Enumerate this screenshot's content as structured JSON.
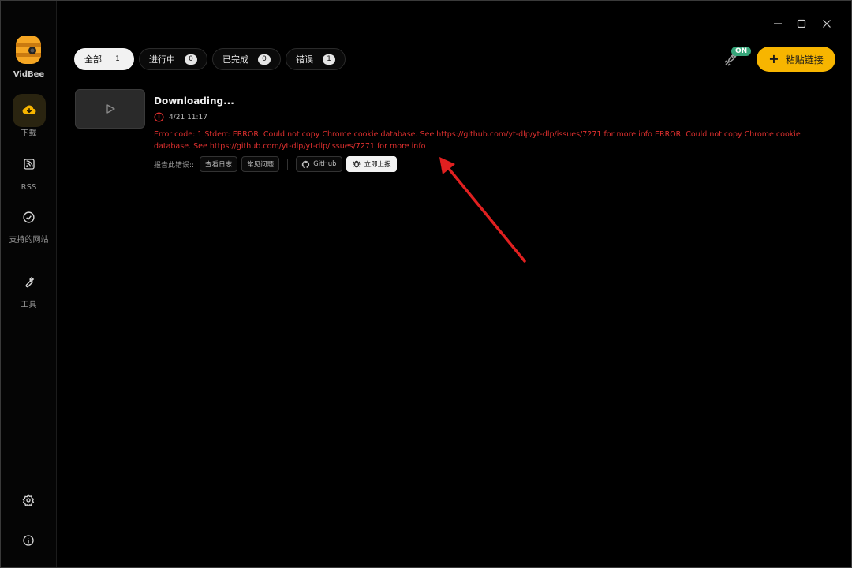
{
  "app": {
    "name": "VidBee"
  },
  "sidebar": {
    "items": [
      {
        "label": "下载",
        "icon": "download-cloud-icon",
        "active": true
      },
      {
        "label": "RSS",
        "icon": "rss-icon",
        "active": false
      },
      {
        "label": "支持的网站",
        "icon": "check-circle-icon",
        "active": false
      },
      {
        "label": "工具",
        "icon": "wrench-icon",
        "active": false
      }
    ],
    "bottom": [
      {
        "icon": "gear-icon"
      },
      {
        "icon": "info-icon"
      }
    ]
  },
  "window_controls": [
    "minimize-icon",
    "maximize-icon",
    "close-icon"
  ],
  "filters": [
    {
      "label": "全部",
      "count": "1",
      "active": true
    },
    {
      "label": "进行中",
      "count": "0",
      "active": false
    },
    {
      "label": "已完成",
      "count": "0",
      "active": false
    },
    {
      "label": "错误",
      "count": "1",
      "active": false
    }
  ],
  "toolbar": {
    "on_badge": "ON",
    "paste_label": "粘贴链接",
    "paste_icon": "plus-icon",
    "rocket_icon": "rocket-icon"
  },
  "download": {
    "title": "Downloading...",
    "date": "4/21 11:17",
    "error": "Error code: 1 Stderr: ERROR: Could not copy Chrome cookie database. See https://github.com/yt-dlp/yt-dlp/issues/7271 for more info ERROR: Could not copy Chrome cookie database. See https://github.com/yt-dlp/yt-dlp/issues/7271 for more info",
    "report_label": "报告此错误::",
    "report_buttons": {
      "view_log": "查看日志",
      "faq": "常见问题",
      "github": "GitHub",
      "report_now": "立即上报"
    }
  },
  "colors": {
    "accent": "#f7b500",
    "error": "#e0302f",
    "on_badge": "#37a67a",
    "annotation_arrow": "#e02020"
  }
}
